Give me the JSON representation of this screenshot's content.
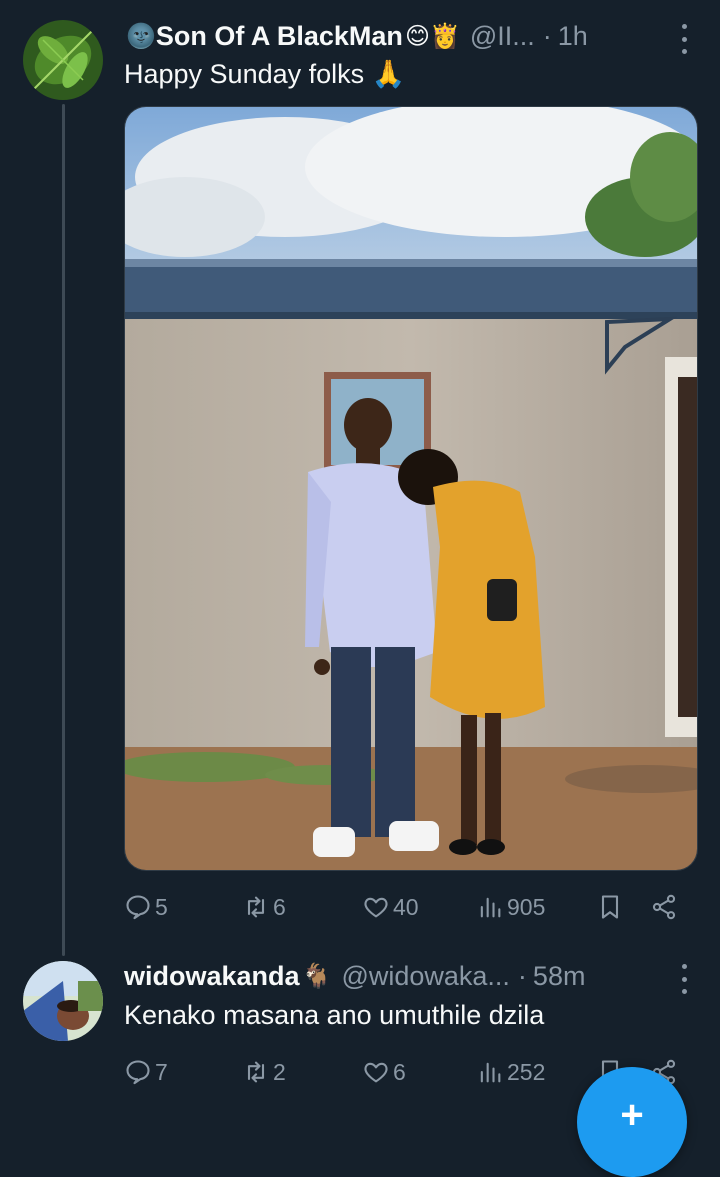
{
  "tweet": {
    "author_name": "Son Of A BlackMan",
    "author_emoji_prefix": "🌚",
    "author_emoji_suffix": "😊👸",
    "handle": "@II...",
    "separator": "·",
    "time": "1h",
    "text": "Happy Sunday folks 🙏",
    "stats": {
      "replies": "5",
      "reposts": "6",
      "likes": "40",
      "views": "905"
    }
  },
  "reply": {
    "author_name": "widowakanda",
    "author_emoji_suffix": "🐐",
    "handle": "@widowaka...",
    "separator": "·",
    "time": "58m",
    "text": "Kenako masana ano umuthile dzila",
    "stats": {
      "replies": "7",
      "reposts": "2",
      "likes": "6",
      "views": "252"
    }
  },
  "fab": {
    "label": "+"
  },
  "icons": {
    "reply": "speech-bubble-icon",
    "repost": "repost-arrows-icon",
    "like": "heart-icon",
    "views": "bar-chart-icon",
    "bookmark": "bookmark-icon",
    "share": "share-nodes-icon",
    "more": "vertical-ellipsis-icon"
  },
  "colors": {
    "background": "#15202b",
    "text": "#f7f9f9",
    "muted": "#8b98a5",
    "accent": "#1d9bf0"
  }
}
